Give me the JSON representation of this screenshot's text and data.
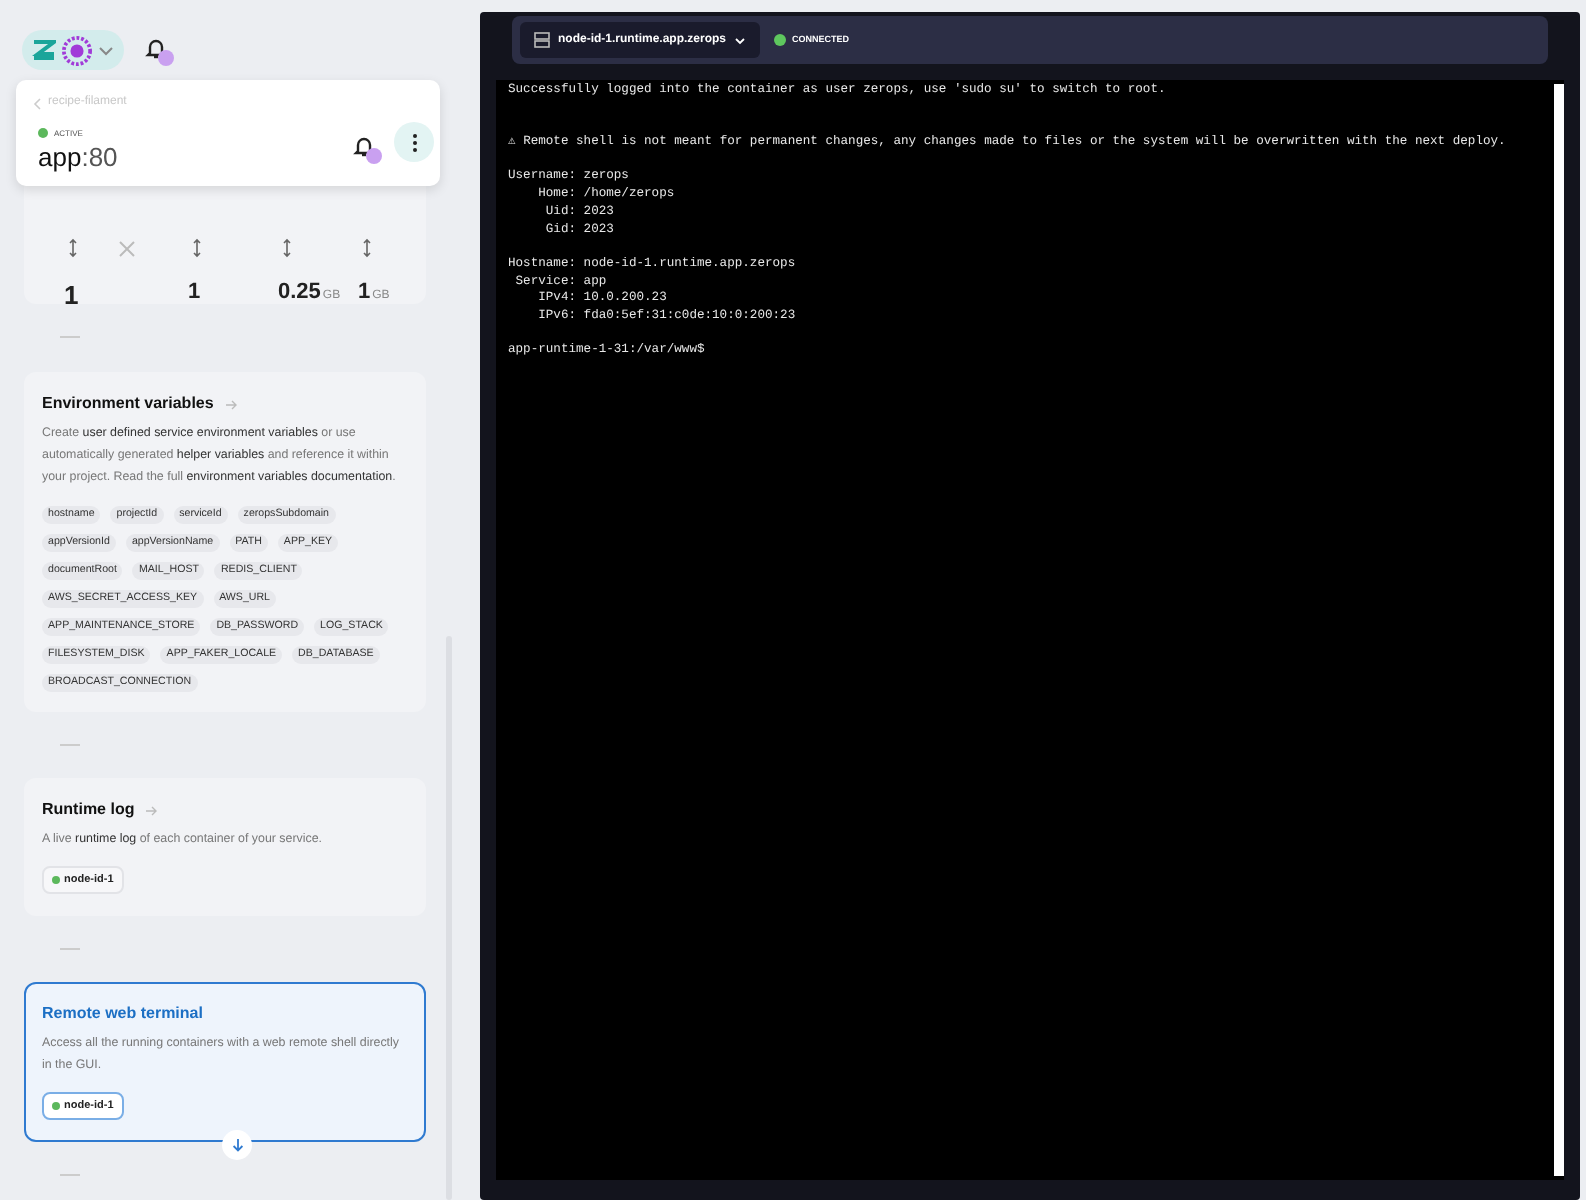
{
  "header": {
    "notifications_badge": true
  },
  "service_card": {
    "breadcrumb": "recipe-filament",
    "status": "ACTIVE",
    "active": true,
    "name": "app",
    "port": ":80",
    "notifications_badge": true
  },
  "scaling": {
    "values": [
      {
        "value": "1"
      },
      {
        "value": "1"
      },
      {
        "value": "0.25",
        "unit": "GB"
      },
      {
        "value": "1",
        "unit": "GB"
      }
    ]
  },
  "sections": [
    {
      "kind": "env",
      "title": "Environment variables",
      "selected": false,
      "description": "Create **user defined service environment variables** or use automatically generated **helper variables** and reference it within your project. Read the full **environment variables documentation**.",
      "tags": [
        "hostname",
        "projectId",
        "serviceId",
        "zeropsSubdomain",
        "appVersionId",
        "appVersionName",
        "PATH",
        "APP_KEY",
        "documentRoot",
        "MAIL_HOST",
        "REDIS_CLIENT",
        "AWS_SECRET_ACCESS_KEY",
        "AWS_URL",
        "APP_MAINTENANCE_STORE",
        "DB_PASSWORD",
        "LOG_STACK",
        "FILESYSTEM_DISK",
        "APP_FAKER_LOCALE",
        "DB_DATABASE",
        "BROADCAST_CONNECTION"
      ]
    },
    {
      "kind": "node",
      "title": "Runtime log",
      "selected": false,
      "description": "A live **runtime log** of each container of your service.",
      "node": "node-id-1"
    },
    {
      "kind": "node",
      "title": "Remote web terminal",
      "selected": true,
      "description": "Access all the running containers with a web remote shell directly in the GUI.",
      "node": "node-id-1"
    }
  ],
  "terminal": {
    "host": "node-id-1.runtime.app.zerops",
    "connected": true,
    "status": "CONNECTED",
    "blocks": [
      {
        "kind": "greeting",
        "lines": [
          "Successfully logged into the container as user zerops, use 'sudo su' to switch to root."
        ]
      },
      {
        "kind": "output",
        "lines": [
          "⚠ Remote shell is not meant for permanent changes, any changes made to files or the system will be overwritten with the next deploy."
        ]
      },
      {
        "kind": "output",
        "lines": [
          "Username: zerops",
          "    Home: /home/zerops",
          "     Uid: 2023",
          "     Gid: 2023"
        ]
      },
      {
        "kind": "output",
        "lines": [
          "Hostname: node-id-1.runtime.app.zerops",
          " Service: app",
          "    IPv4: 10.0.200.23",
          "    IPv6: fda0:5ef:31:c0de:10:0:200:23"
        ]
      },
      {
        "kind": "prompt",
        "lines": [
          "app-runtime-1-31:/var/www$"
        ]
      }
    ]
  }
}
